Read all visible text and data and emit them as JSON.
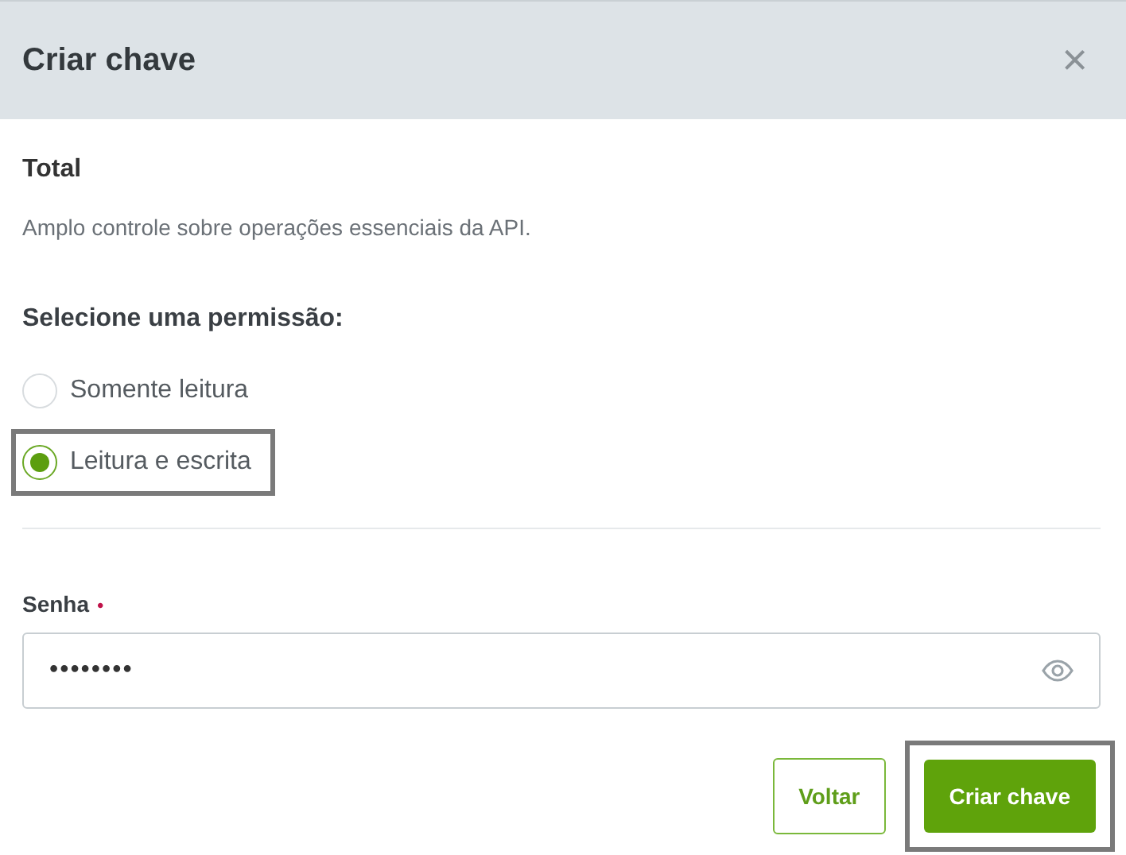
{
  "dialog": {
    "title": "Criar chave",
    "close": "×"
  },
  "section": {
    "title": "Total",
    "description": "Amplo controle sobre operações essenciais da API."
  },
  "permission": {
    "label": "Selecione uma permissão:",
    "options": [
      {
        "label": "Somente leitura",
        "selected": false,
        "highlighted": false
      },
      {
        "label": "Leitura e escrita",
        "selected": true,
        "highlighted": true
      }
    ]
  },
  "password": {
    "label": "Senha",
    "required_mark": "•",
    "value": "••••••••"
  },
  "buttons": [
    {
      "label": "Voltar",
      "kind": "secondary",
      "highlighted": false
    },
    {
      "label": "Criar chave",
      "kind": "primary",
      "highlighted": true
    }
  ]
}
